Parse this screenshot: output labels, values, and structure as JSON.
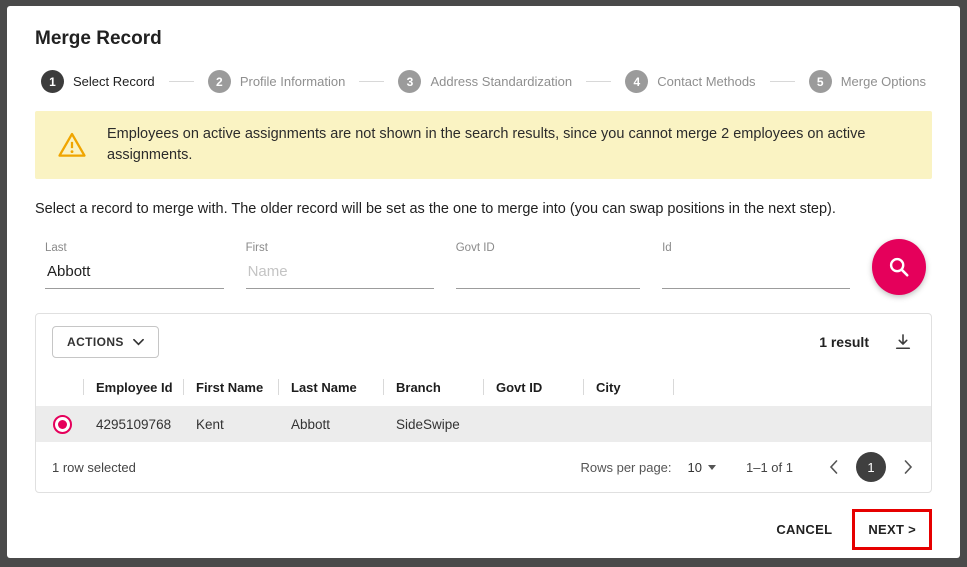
{
  "dialog": {
    "title": "Merge Record"
  },
  "stepper": {
    "steps": [
      {
        "number": "1",
        "label": "Select Record"
      },
      {
        "number": "2",
        "label": "Profile Information"
      },
      {
        "number": "3",
        "label": "Address Standardization"
      },
      {
        "number": "4",
        "label": "Contact Methods"
      },
      {
        "number": "5",
        "label": "Merge Options"
      }
    ]
  },
  "warning": {
    "text": "Employees on active assignments are not shown in the search results, since you cannot merge 2 employees on active assignments."
  },
  "instruction": "Select a record to merge with. The older record will be set as the one to merge into (you can swap positions in the next step).",
  "search_form": {
    "fields": [
      {
        "label": "Last",
        "value": "Abbott"
      },
      {
        "label": "First",
        "placeholder": "Name"
      },
      {
        "label": "Govt ID",
        "value": ""
      },
      {
        "label": "Id",
        "value": ""
      }
    ]
  },
  "table": {
    "actions_label": "ACTIONS",
    "result_count": "1 result",
    "columns": [
      "Employee Id",
      "First Name",
      "Last Name",
      "Branch",
      "Govt ID",
      "City"
    ],
    "rows": [
      {
        "employee_id": "4295109768",
        "first_name": "Kent",
        "last_name": "Abbott",
        "branch": "SideSwipe",
        "govt_id": "",
        "city": ""
      }
    ],
    "footer": {
      "selected_text": "1 row selected",
      "rows_per_page_label": "Rows per page:",
      "rows_per_page_value": "10",
      "range_text": "1–1 of 1",
      "current_page": "1"
    }
  },
  "footer_buttons": {
    "cancel": "CANCEL",
    "next": "NEXT >"
  },
  "colors": {
    "accent": "#e5005b",
    "warning_bg": "#faf3c3",
    "warning_icon": "#f0a500",
    "step_active": "#3c3c3c",
    "step_inactive": "#9b9b9b",
    "annotation": "#e60000"
  }
}
